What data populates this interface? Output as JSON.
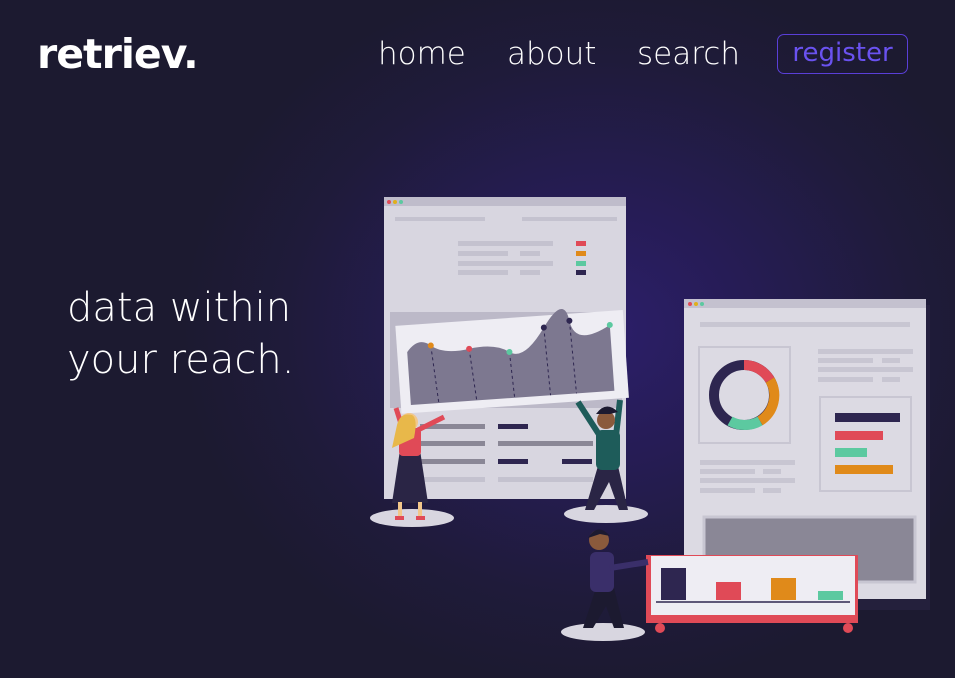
{
  "brand": {
    "logo_text": "retriev."
  },
  "nav": {
    "items": [
      {
        "label": "home"
      },
      {
        "label": "about"
      },
      {
        "label": "search"
      }
    ],
    "register_label": "register"
  },
  "hero": {
    "line1": "data within",
    "line2": "your reach."
  },
  "colors": {
    "background": "#1f1b3a",
    "accent": "#5a3fd8",
    "chart_red": "#e04a57",
    "chart_orange": "#e08a1a",
    "chart_green": "#5cc9a0",
    "chart_navy": "#2e2650"
  },
  "illustration": {
    "name": "dashboard-illustration",
    "depicts": [
      "line-chart-panel",
      "donut-chart-panel",
      "bar-chart-cart",
      "people-holding-charts"
    ]
  }
}
